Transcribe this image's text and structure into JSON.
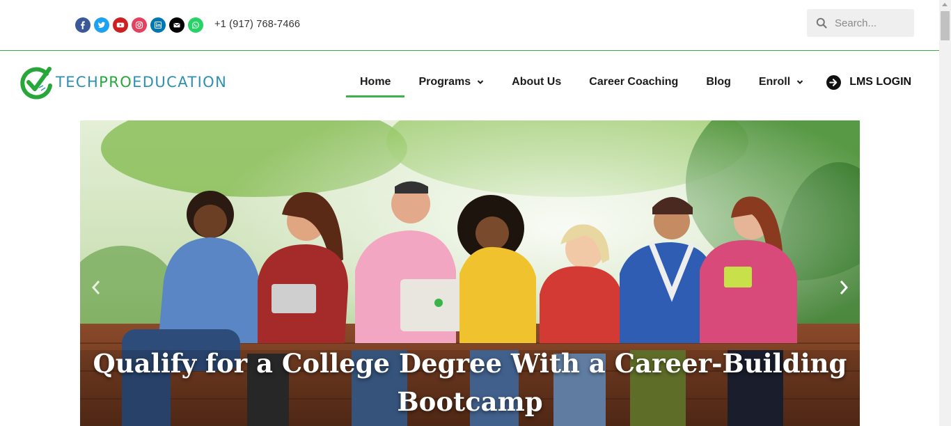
{
  "topbar": {
    "socials": [
      {
        "name": "facebook-icon",
        "color": "#3b5998"
      },
      {
        "name": "twitter-icon",
        "color": "#1da1f2"
      },
      {
        "name": "youtube-icon",
        "color": "#cd201f"
      },
      {
        "name": "instagram-icon",
        "color": "#e4405f"
      },
      {
        "name": "linkedin-icon",
        "color": "#0077b5"
      },
      {
        "name": "envelope-icon",
        "color": "#000000"
      },
      {
        "name": "whatsapp-icon",
        "color": "#25d366"
      }
    ],
    "phone": "+1 (917) 768-7466",
    "search": {
      "placeholder": "Search..."
    }
  },
  "header": {
    "logo": {
      "part1": "TECH",
      "part2": "PRO",
      "part3": "EDUCATION"
    },
    "nav": {
      "home": "Home",
      "programs": "Programs",
      "about": "About Us",
      "career": "Career Coaching",
      "blog": "Blog",
      "enroll": "Enroll",
      "lms": "LMS LOGIN"
    }
  },
  "hero": {
    "title": "Qualify for a College Degree With a Career-Building Bootcamp"
  },
  "colors": {
    "accent": "#3ab34a",
    "logo_blue": "#2f8fb0",
    "logo_green": "#27a73a"
  }
}
